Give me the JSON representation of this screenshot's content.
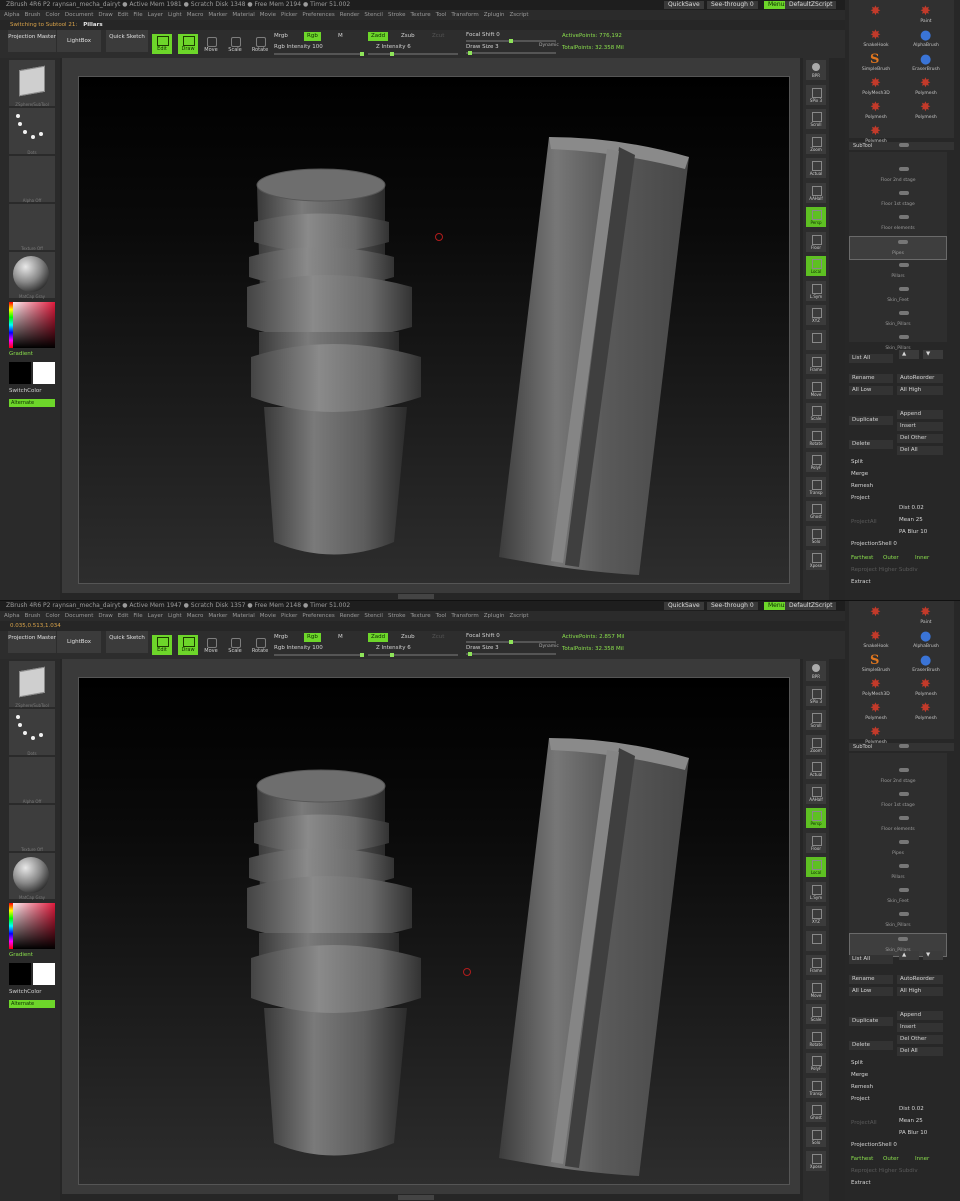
{
  "shots": [
    {
      "titlebar": "ZBrush 4R6 P2    raynsan_mecha_dairyt    ● Active Mem 1981 ● Scratch Disk 1348 ● Free Mem 2194 ● Timer 51.002",
      "note": "Switching to Subtool 21:",
      "note_value": "Pillars",
      "active_points": "ActivePoints: 776,192",
      "total_points": "TotalPoints: 32.358 Mil",
      "coords": ""
    },
    {
      "titlebar": "ZBrush 4R6 P2    raynsan_mecha_dairyt    ● Active Mem 1947 ● Scratch Disk 1357 ● Free Mem 2148 ● Timer 51.002",
      "note": "0.035,0.513,1.034",
      "note_value": "",
      "active_points": "ActivePoints: 2.857 Mil",
      "total_points": "TotalPoints: 32.358 Mil",
      "coords": ""
    }
  ],
  "titlebar_right": {
    "quicksave": "QuickSave",
    "see_through": "See-through  0",
    "menus": "Menus",
    "default_script": "DefaultZScript"
  },
  "menubar": [
    "Alpha",
    "Brush",
    "Color",
    "Document",
    "Draw",
    "Edit",
    "File",
    "Layer",
    "Light",
    "Macro",
    "Marker",
    "Material",
    "Movie",
    "Picker",
    "Preferences",
    "Render",
    "Stencil",
    "Stroke",
    "Texture",
    "Tool",
    "Transform",
    "Zplugin",
    "Zscript"
  ],
  "toolbar": {
    "projection_master": "Projection Master",
    "lightbox": "LightBox",
    "quick_sketch": "Quick Sketch",
    "edit": "Edit",
    "draw": "Draw",
    "move": "Move",
    "scale": "Scale",
    "rotate": "Rotate",
    "mrgb": "Mrgb",
    "rgb": "Rgb",
    "m": "M",
    "zadd": "Zadd",
    "zsub": "Zsub",
    "zcut": "Zcut",
    "rgb_intensity": "Rgb Intensity 100",
    "z_intensity": "Z Intensity 6",
    "focal_shift": "Focal Shift 0",
    "draw_size": "Draw Size 3",
    "dynamic": "Dynamic"
  },
  "left_palette": {
    "tool_caption": "ZSphere/SubTool",
    "brush_caption": "Dots",
    "alpha_caption": "Alpha Off",
    "texture_caption": "Texture Off",
    "material_caption": "MatCap Gray",
    "gradient": "Gradient",
    "switch_color": "SwitchColor",
    "alternate": "Alternate",
    "colors": {
      "main": "#000000",
      "secondary": "#ffffff"
    }
  },
  "right_toolbar": [
    "BPR",
    "SPix 3",
    "Scroll",
    "Zoom",
    "Actual",
    "AAHalf",
    "Persp",
    "Floor",
    "Local",
    "L.Sym",
    "XYZ",
    "",
    "Frame",
    "Move",
    "Scale",
    "Rotate",
    "PolyF",
    "Transp",
    "Ghost",
    "Solo",
    "Xpose"
  ],
  "brush_palette": [
    {
      "name": "",
      "kind": "r"
    },
    {
      "name": "Paint",
      "kind": "r"
    },
    {
      "name": "SnakeHook",
      "kind": "r"
    },
    {
      "name": "AlphaBrush",
      "kind": "a"
    },
    {
      "name": "SimpleBrush",
      "kind": "s"
    },
    {
      "name": "EraserBrush",
      "kind": "a"
    },
    {
      "name": "PolyMesh3D",
      "kind": "r"
    },
    {
      "name": "Polymesh",
      "kind": "r"
    },
    {
      "name": "Polymesh",
      "kind": "r"
    },
    {
      "name": "Polymesh",
      "kind": "r"
    },
    {
      "name": "Polymesh",
      "kind": "r"
    }
  ],
  "subtool": {
    "header": "SubTool",
    "items": [
      "",
      "Floor 2nd stage",
      "Floor 1st stage",
      "Floor elements",
      "Pipes",
      "Pillars",
      "Skin_Feet",
      "Skin_Pillars",
      "Skin_Pillars"
    ],
    "list_all": "List All",
    "rename": "Rename",
    "auto_reorder": "AutoReorder",
    "all_low": "All Low",
    "all_high": "All High",
    "duplicate": "Duplicate",
    "append": "Append",
    "insert": "Insert",
    "delete": "Delete",
    "del_other": "Del Other",
    "del_all": "Del All",
    "split": "Split",
    "merge": "Merge",
    "remesh": "Remesh",
    "project": "Project",
    "dist": "Dist 0.02",
    "project_all": "ProjectAll",
    "mean": "Mean 25",
    "pa_blur": "PA Blur 10",
    "projection_shell": "ProjectionShell 0",
    "farthest": "Farthest",
    "outer": "Outer",
    "inner": "Inner",
    "reproject": "Reproject Higher Subdiv",
    "extract": "Extract"
  }
}
